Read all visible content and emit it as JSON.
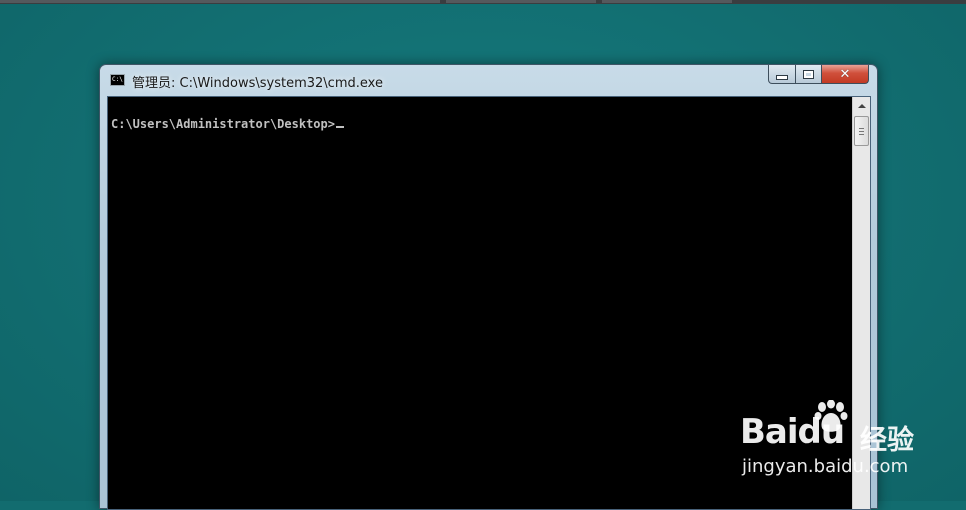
{
  "window": {
    "title": "管理员: C:\\Windows\\system32\\cmd.exe",
    "icon": "cmd-icon",
    "controls": {
      "minimize": "minimize-icon",
      "maximize": "maximize-icon",
      "close_symbol": "✕"
    }
  },
  "console": {
    "prompt": "C:\\Users\\Administrator\\Desktop>"
  },
  "watermark": {
    "brand": "Baidu",
    "cn": "经验",
    "url": "jingyan.baidu.com"
  },
  "colors": {
    "desktop": "#126c6f",
    "console_bg": "#000000",
    "console_text": "#c0c0c0",
    "close_button": "#c94a35"
  }
}
